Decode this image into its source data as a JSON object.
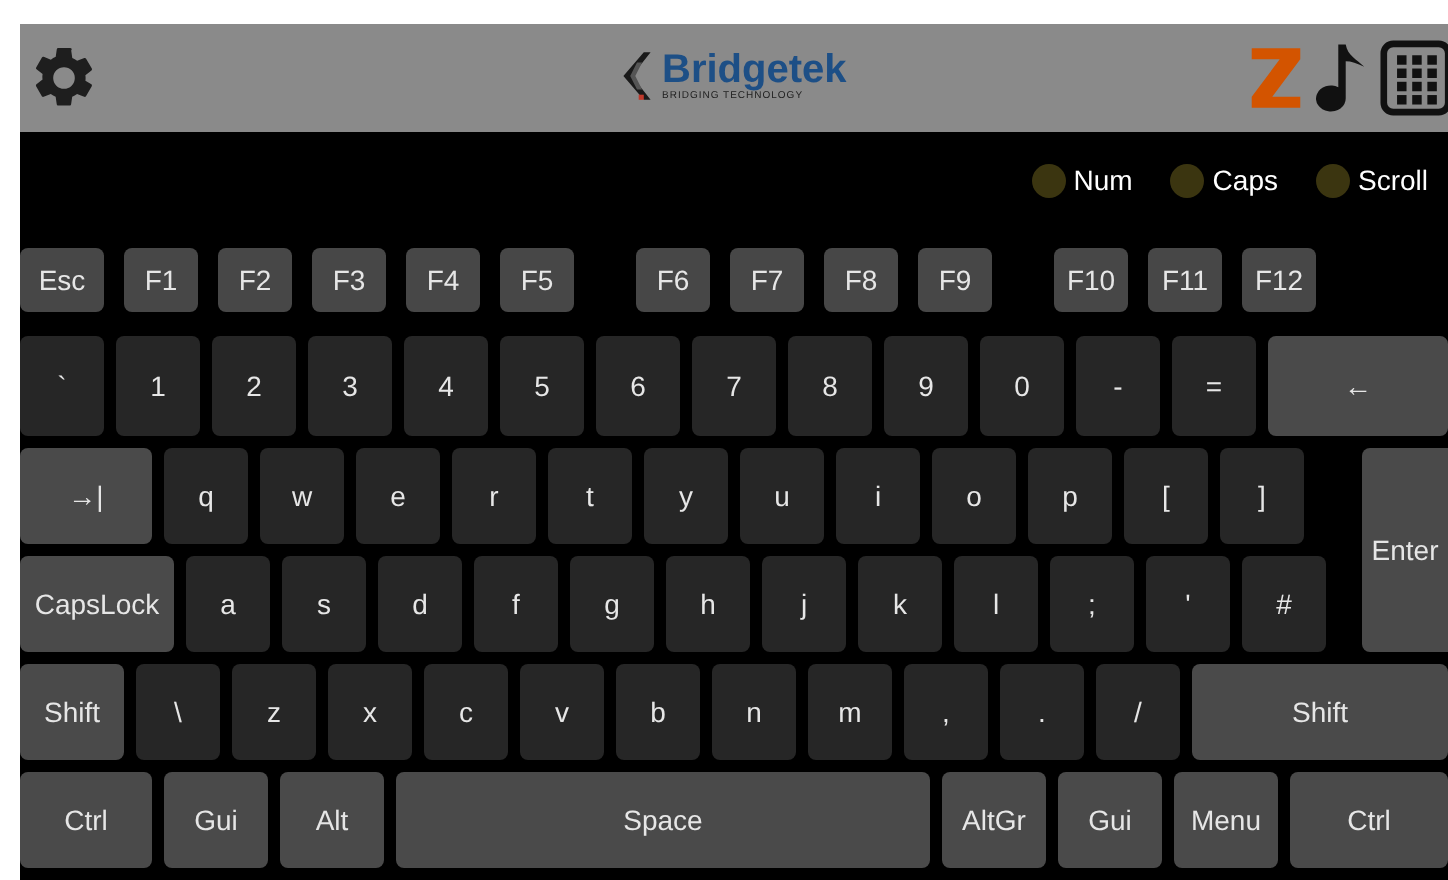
{
  "top_bar": {
    "logo": {
      "name": "Bridgetek",
      "tagline": "BRIDGING TECHNOLOGY"
    }
  },
  "indicators": [
    {
      "label": "Num",
      "on": false
    },
    {
      "label": "Caps",
      "on": false
    },
    {
      "label": "Scroll",
      "on": false
    }
  ],
  "function_groups": [
    [
      {
        "label": "Esc",
        "kind": "escape"
      },
      {
        "label": "F1",
        "kind": "function"
      },
      {
        "label": "F2",
        "kind": "function"
      },
      {
        "label": "F3",
        "kind": "function"
      },
      {
        "label": "F4",
        "kind": "function"
      },
      {
        "label": "F5",
        "kind": "function"
      }
    ],
    [
      {
        "label": "F6",
        "kind": "function"
      },
      {
        "label": "F7",
        "kind": "function"
      },
      {
        "label": "F8",
        "kind": "function"
      },
      {
        "label": "F9",
        "kind": "function"
      }
    ],
    [
      {
        "label": "F10",
        "kind": "function"
      },
      {
        "label": "F11",
        "kind": "function"
      },
      {
        "label": "F12",
        "kind": "function"
      }
    ]
  ],
  "number_row": [
    {
      "label": "`",
      "kind": "char"
    },
    {
      "label": "1",
      "kind": "char"
    },
    {
      "label": "2",
      "kind": "char"
    },
    {
      "label": "3",
      "kind": "char"
    },
    {
      "label": "4",
      "kind": "char"
    },
    {
      "label": "5",
      "kind": "char"
    },
    {
      "label": "6",
      "kind": "char"
    },
    {
      "label": "7",
      "kind": "char"
    },
    {
      "label": "8",
      "kind": "char"
    },
    {
      "label": "9",
      "kind": "char"
    },
    {
      "label": "0",
      "kind": "char"
    },
    {
      "label": "-",
      "kind": "char"
    },
    {
      "label": "=",
      "kind": "char"
    },
    {
      "label": "←",
      "kind": "backspace"
    }
  ],
  "top_row": [
    {
      "label": "→|",
      "kind": "tab"
    },
    {
      "label": "q",
      "kind": "char"
    },
    {
      "label": "w",
      "kind": "char"
    },
    {
      "label": "e",
      "kind": "char"
    },
    {
      "label": "r",
      "kind": "char"
    },
    {
      "label": "t",
      "kind": "char"
    },
    {
      "label": "y",
      "kind": "char"
    },
    {
      "label": "u",
      "kind": "char"
    },
    {
      "label": "i",
      "kind": "char"
    },
    {
      "label": "o",
      "kind": "char"
    },
    {
      "label": "p",
      "kind": "char"
    },
    {
      "label": "[",
      "kind": "char"
    },
    {
      "label": "]",
      "kind": "char"
    }
  ],
  "enter_key": "Enter",
  "home_row": [
    {
      "label": "CapsLock",
      "kind": "capslock"
    },
    {
      "label": "a",
      "kind": "char"
    },
    {
      "label": "s",
      "kind": "char"
    },
    {
      "label": "d",
      "kind": "char"
    },
    {
      "label": "f",
      "kind": "char"
    },
    {
      "label": "g",
      "kind": "char"
    },
    {
      "label": "h",
      "kind": "char"
    },
    {
      "label": "j",
      "kind": "char"
    },
    {
      "label": "k",
      "kind": "char"
    },
    {
      "label": "l",
      "kind": "char"
    },
    {
      "label": ";",
      "kind": "char"
    },
    {
      "label": "'",
      "kind": "char"
    },
    {
      "label": "#",
      "kind": "char"
    }
  ],
  "bottom_row": [
    {
      "label": "Shift",
      "kind": "shift"
    },
    {
      "label": "\\",
      "kind": "char"
    },
    {
      "label": "z",
      "kind": "char"
    },
    {
      "label": "x",
      "kind": "char"
    },
    {
      "label": "c",
      "kind": "char"
    },
    {
      "label": "v",
      "kind": "char"
    },
    {
      "label": "b",
      "kind": "char"
    },
    {
      "label": "n",
      "kind": "char"
    },
    {
      "label": "m",
      "kind": "char"
    },
    {
      "label": ",",
      "kind": "char"
    },
    {
      "label": ".",
      "kind": "char"
    },
    {
      "label": "/",
      "kind": "char"
    },
    {
      "label": "Shift",
      "kind": "shift"
    }
  ],
  "space_row": [
    {
      "label": "Ctrl",
      "kind": "ctrl"
    },
    {
      "label": "Gui",
      "kind": "gui"
    },
    {
      "label": "Alt",
      "kind": "alt"
    },
    {
      "label": "Space",
      "kind": "space"
    },
    {
      "label": "AltGr",
      "kind": "altgr"
    },
    {
      "label": "Gui",
      "kind": "gui"
    },
    {
      "label": "Menu",
      "kind": "menu"
    },
    {
      "label": "Ctrl",
      "kind": "ctrl"
    }
  ]
}
